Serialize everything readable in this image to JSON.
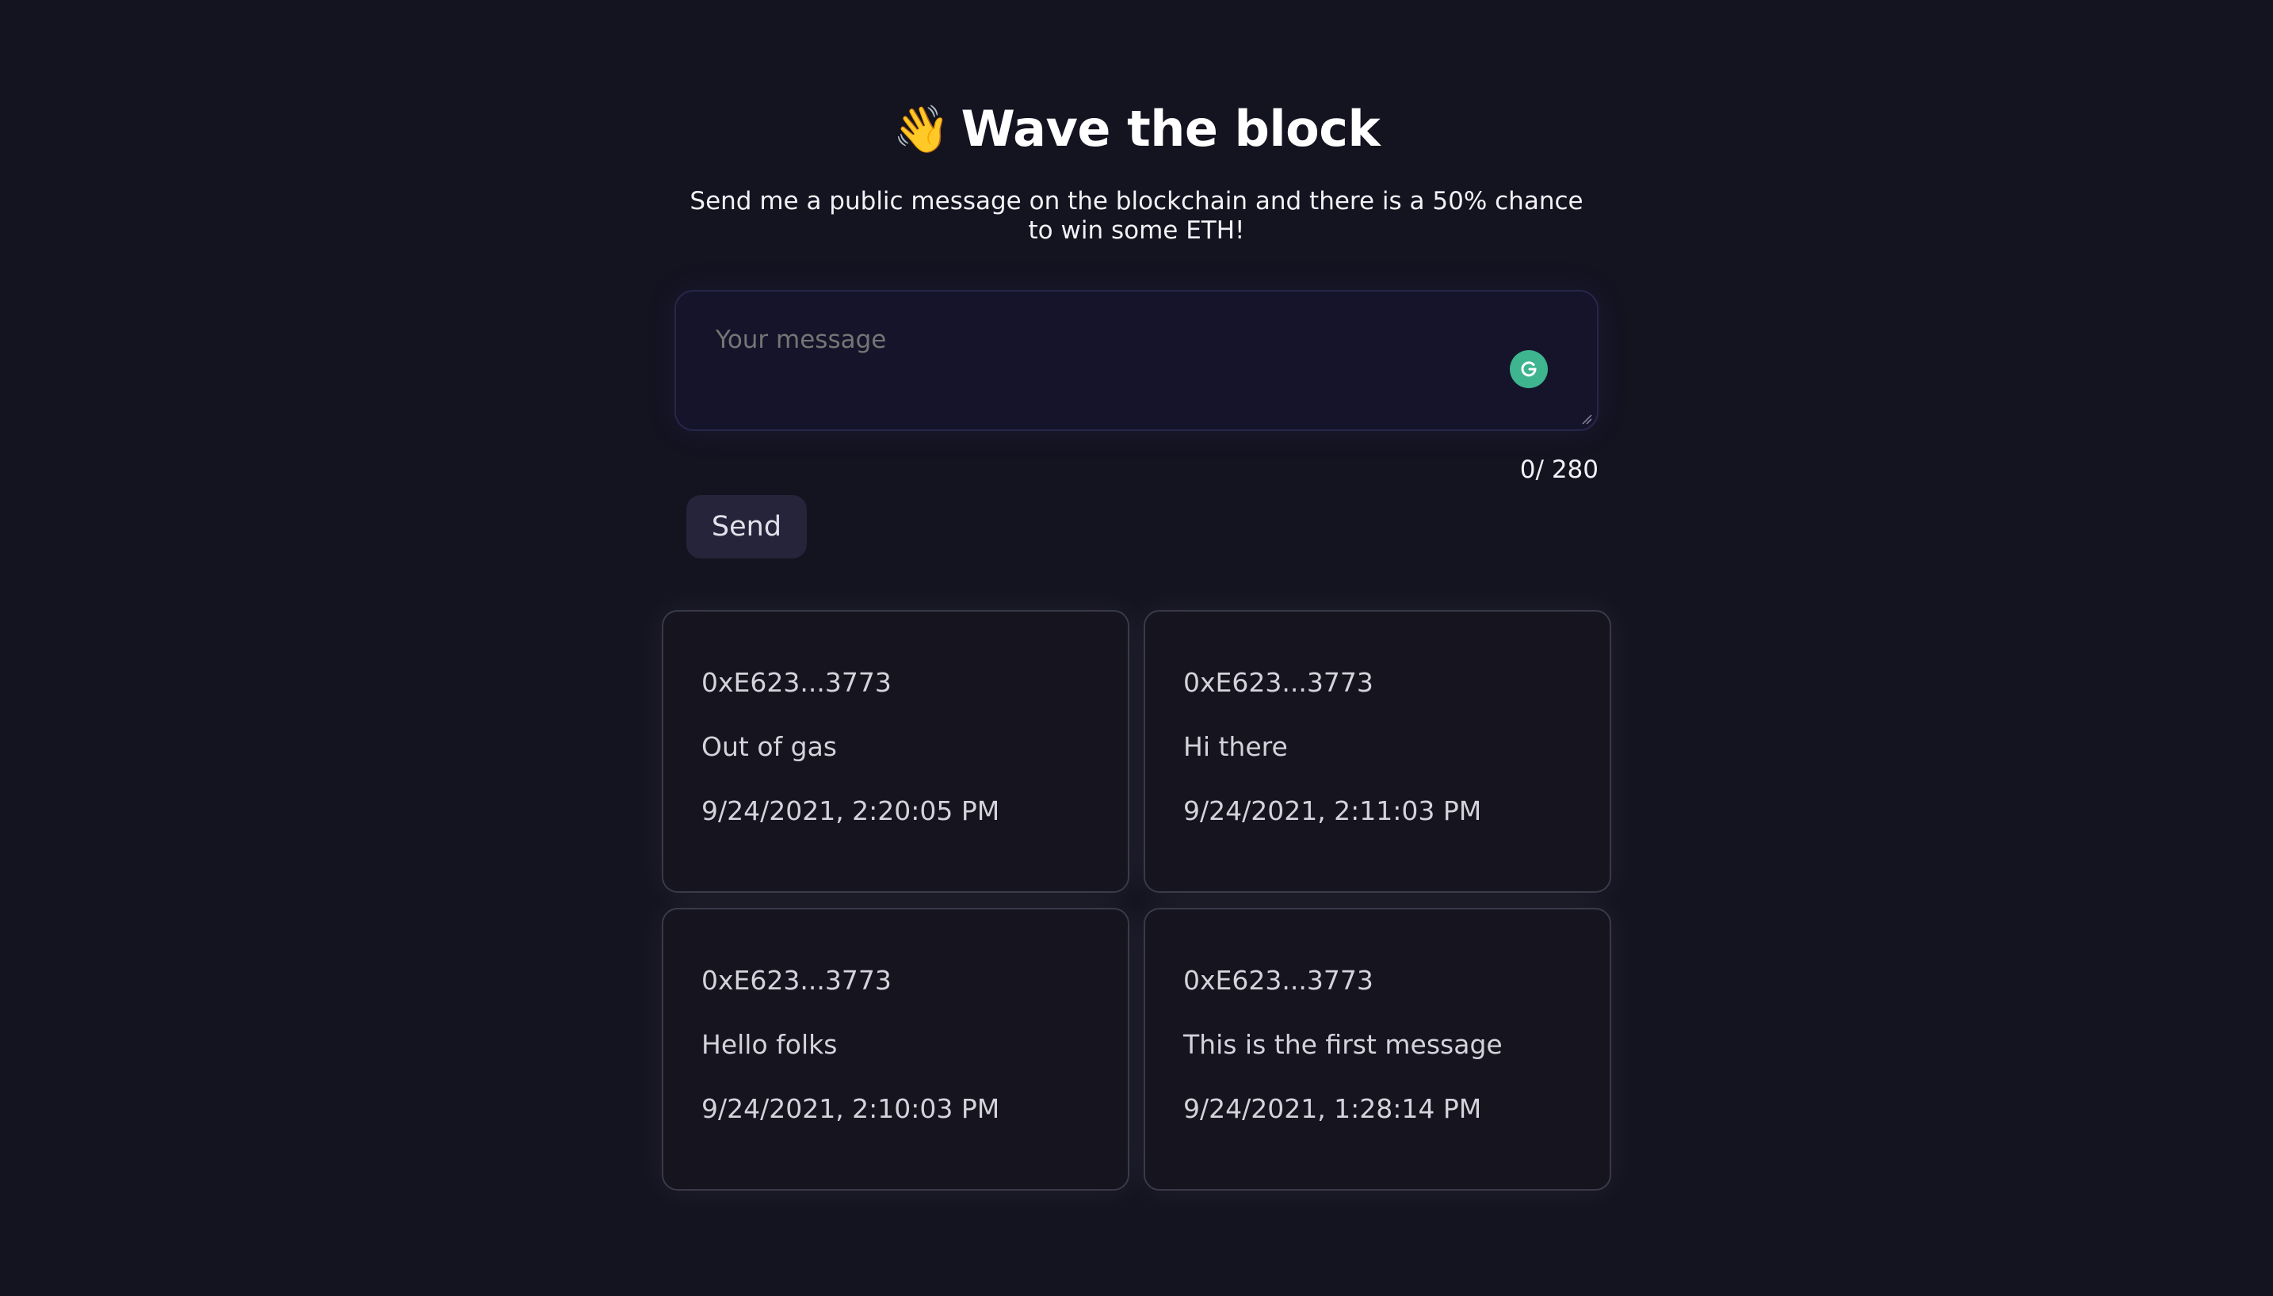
{
  "header": {
    "icon": "👋",
    "title": "Wave the block",
    "subtitle": "Send me a public message on the blockchain and there is a 50% chance to win some ETH!"
  },
  "composer": {
    "placeholder": "Your message",
    "value": "",
    "char_count": "0/ 280",
    "send_label": "Send",
    "grammarly_icon": "grammarly-icon"
  },
  "messages": [
    {
      "address": "0xE623...3773",
      "text": "Out of gas",
      "timestamp": "9/24/2021, 2:20:05 PM"
    },
    {
      "address": "0xE623...3773",
      "text": "Hi there",
      "timestamp": "9/24/2021, 2:11:03 PM"
    },
    {
      "address": "0xE623...3773",
      "text": "Hello folks",
      "timestamp": "9/24/2021, 2:10:03 PM"
    },
    {
      "address": "0xE623...3773",
      "text": "This is the first message",
      "timestamp": "9/24/2021, 1:28:14 PM"
    }
  ],
  "colors": {
    "background": "#141320",
    "card_border": "#3a3948",
    "grammarly": "#3eb58f",
    "button": "#25243a"
  }
}
